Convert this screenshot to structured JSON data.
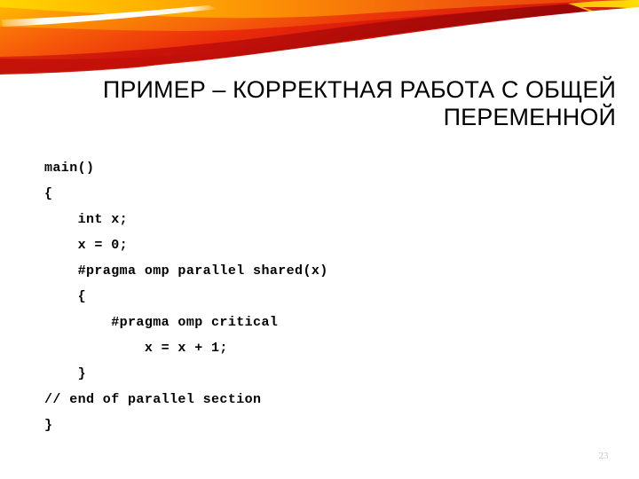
{
  "slide": {
    "background_color": "#ffffff",
    "title": "ПРИМЕР – КОРРЕКТНАЯ РАБОТА С ОБЩЕЙ ПЕРЕМЕННОЙ",
    "page_number": "23"
  },
  "header_graphic": {
    "name": "orange-wave-banner",
    "colors": {
      "yellow": "#ffd500",
      "light_orange": "#ffa314",
      "orange": "#f97605",
      "red_orange": "#ef4a0c",
      "red": "#e01b0c",
      "dark_red": "#b60d0a",
      "white_streak": "#ffffff"
    }
  },
  "code": {
    "language": "c-openmp",
    "lines": [
      "main()",
      "{",
      "    int x;",
      "    x = 0;",
      "    #pragma omp parallel shared(x)",
      "    {",
      "        #pragma omp critical",
      "            x = x + 1;",
      "    }",
      "// end of parallel section",
      "}"
    ]
  }
}
